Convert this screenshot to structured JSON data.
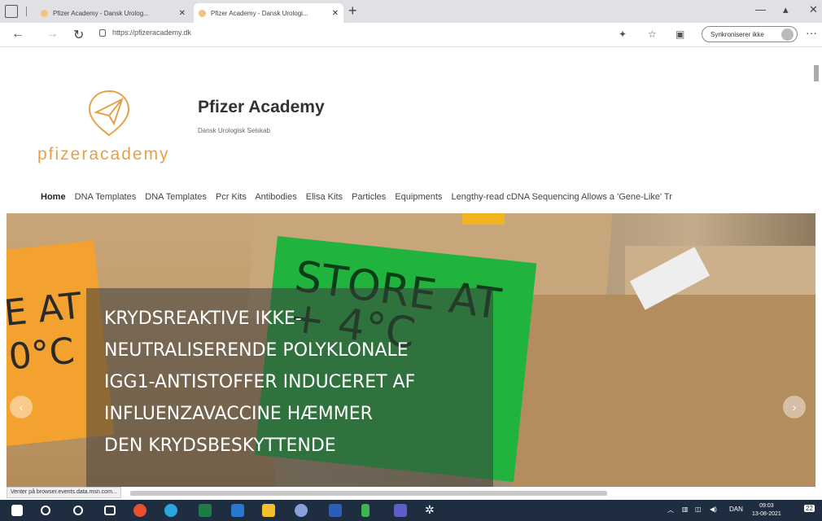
{
  "browser": {
    "tabs": [
      {
        "title": "Pfizer Academy - Dansk Urolog..."
      },
      {
        "title": "Pfizer Academy - Dansk Urologi..."
      }
    ],
    "url": "https://pfizeracademy.dk",
    "sync_label": "Synkroniserer ikke"
  },
  "site": {
    "logo_text": "pfizeracademy",
    "title": "Pfizer Academy",
    "tagline": "Dansk Urologisk Selskab",
    "menu": [
      "Home",
      "DNA Templates",
      "DNA Templates",
      "Pcr Kits",
      "Antibodies",
      "Elisa Kits",
      "Particles",
      "Equipments",
      "Lengthy-read cDNA Sequencing Allows a 'Gene-Like' Tr"
    ]
  },
  "hero": {
    "caption": "KRYDSREAKTIVE IKKE-NEUTRALISERENDE POLYKLONALE IGG1-ANTISTOFFER INDUCERET AF INFLUENZAVACCINE HÆMMER DEN KRYDSBESKYTTENDE",
    "caption_lines": [
      "KRYDSREAKTIVE IKKE-",
      "NEUTRALISERENDE POLYKLONALE",
      "IGG1-ANTISTOFFER INDUCERET AF",
      "INFLUENZAVACCINE HÆMMER",
      "DEN KRYDSBESKYTTENDE"
    ],
    "bg_label_left": "E AT\n0°C",
    "bg_label_green": "STORE AT\n+ 4°C"
  },
  "status": {
    "text": "Venter på browser.events.data.msn.com..."
  },
  "taskbar": {
    "language": "DAN",
    "time": "09:03",
    "date": "13-08-2021",
    "notifications": "22"
  },
  "colors": {
    "logo_orange": "#e6a04b",
    "taskbar_bg": "#1f2d40",
    "label_green": "#20b33e",
    "label_orange": "#f3a12f"
  }
}
